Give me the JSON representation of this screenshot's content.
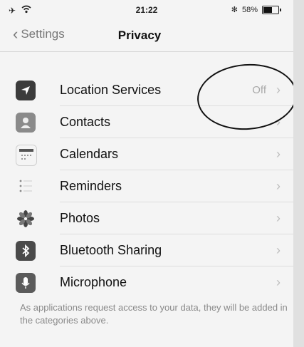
{
  "status_bar": {
    "time": "21:22",
    "battery_text": "58%",
    "battery_level": 0.58
  },
  "nav": {
    "back_label": "Settings",
    "title": "Privacy"
  },
  "items": [
    {
      "label": "Location Services",
      "detail": "Off",
      "icon": "location-arrow-icon",
      "icon_color": "#3b3b3b"
    },
    {
      "label": "Contacts",
      "detail": "",
      "icon": "contacts-icon",
      "icon_color": "#8a8a8a"
    },
    {
      "label": "Calendars",
      "detail": "",
      "icon": "calendar-icon",
      "icon_color": "#d8d8d8"
    },
    {
      "label": "Reminders",
      "detail": "",
      "icon": "reminders-icon",
      "icon_color": "#f0f0f0"
    },
    {
      "label": "Photos",
      "detail": "",
      "icon": "photos-flower-icon",
      "icon_color": "#7a7a7a"
    },
    {
      "label": "Bluetooth Sharing",
      "detail": "",
      "icon": "bluetooth-icon",
      "icon_color": "#4a4a4a"
    },
    {
      "label": "Microphone",
      "detail": "",
      "icon": "microphone-icon",
      "icon_color": "#5b5b5b"
    }
  ],
  "footnote": "As applications request access to your data, they will be added in the categories above."
}
